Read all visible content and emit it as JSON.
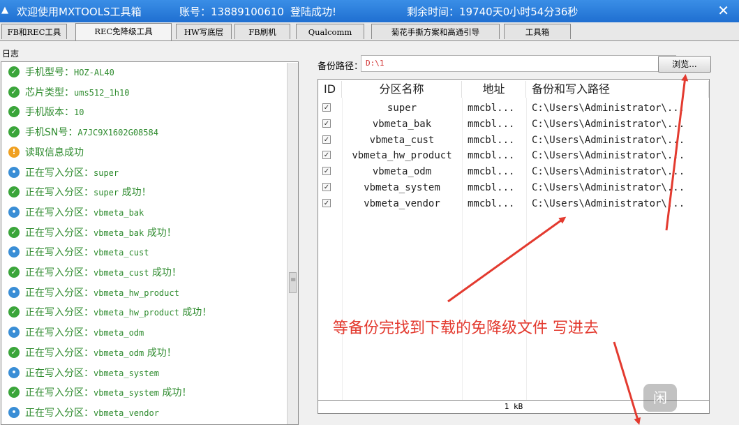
{
  "titlebar": {
    "app_title": "欢迎使用MXTOOLS工具箱",
    "account": "账号：13889100610",
    "login_status": "登陆成功!",
    "remaining_time": "剩余时间：19740天0小时54分36秒"
  },
  "tabs": [
    {
      "label": "FB和REC工具"
    },
    {
      "label": "REC免降级工具"
    },
    {
      "label": "HW写底层"
    },
    {
      "label": "FB刷机"
    },
    {
      "label": "Qualcomm"
    },
    {
      "label": "菊花手撕方案和高通引导"
    },
    {
      "label": "工具箱"
    }
  ],
  "log": {
    "label": "日志",
    "lines": [
      {
        "status": "success",
        "text": "手机型号：",
        "value": "HOZ-AL40",
        "suffix": ""
      },
      {
        "status": "success",
        "text": "芯片类型：",
        "value": "ums512_1h10",
        "suffix": ""
      },
      {
        "status": "success",
        "text": "手机版本：",
        "value": "10",
        "suffix": ""
      },
      {
        "status": "success",
        "text": "手机SN号：",
        "value": "A7JC9X1602G08584",
        "suffix": ""
      },
      {
        "status": "warning",
        "text": "读取信息成功",
        "value": "",
        "suffix": ""
      },
      {
        "status": "info",
        "text": "正在写入分区：",
        "value": "super",
        "suffix": ""
      },
      {
        "status": "success",
        "text": "正在写入分区：",
        "value": "super",
        "suffix": " 成功！"
      },
      {
        "status": "info",
        "text": "正在写入分区：",
        "value": "vbmeta_bak",
        "suffix": ""
      },
      {
        "status": "success",
        "text": "正在写入分区：",
        "value": "vbmeta_bak",
        "suffix": " 成功！"
      },
      {
        "status": "info",
        "text": "正在写入分区：",
        "value": "vbmeta_cust",
        "suffix": ""
      },
      {
        "status": "success",
        "text": "正在写入分区：",
        "value": "vbmeta_cust",
        "suffix": " 成功！"
      },
      {
        "status": "info",
        "text": "正在写入分区：",
        "value": "vbmeta_hw_product",
        "suffix": ""
      },
      {
        "status": "success",
        "text": "正在写入分区：",
        "value": "vbmeta_hw_product",
        "suffix": " 成功！"
      },
      {
        "status": "info",
        "text": "正在写入分区：",
        "value": "vbmeta_odm",
        "suffix": ""
      },
      {
        "status": "success",
        "text": "正在写入分区：",
        "value": "vbmeta_odm",
        "suffix": " 成功！"
      },
      {
        "status": "info",
        "text": "正在写入分区：",
        "value": "vbmeta_system",
        "suffix": ""
      },
      {
        "status": "success",
        "text": "正在写入分区：",
        "value": "vbmeta_system",
        "suffix": " 成功！"
      },
      {
        "status": "info",
        "text": "正在写入分区：",
        "value": "vbmeta_vendor",
        "suffix": ""
      }
    ]
  },
  "backup": {
    "label": "备份路径：",
    "path": "D:\\1",
    "browse_label": "浏览..."
  },
  "table": {
    "headers": [
      "ID",
      "分区名称",
      "地址",
      "备份和写入路径"
    ],
    "rows": [
      {
        "checked": true,
        "name": "super",
        "addr": "mmcbl...",
        "path": "C:\\Users\\Administrator\\..."
      },
      {
        "checked": true,
        "name": "vbmeta_bak",
        "addr": "mmcbl...",
        "path": "C:\\Users\\Administrator\\..."
      },
      {
        "checked": true,
        "name": "vbmeta_cust",
        "addr": "mmcbl...",
        "path": "C:\\Users\\Administrator\\..."
      },
      {
        "checked": true,
        "name": "vbmeta_hw_product",
        "addr": "mmcbl...",
        "path": "C:\\Users\\Administrator\\..."
      },
      {
        "checked": true,
        "name": "vbmeta_odm",
        "addr": "mmcbl...",
        "path": "C:\\Users\\Administrator\\..."
      },
      {
        "checked": true,
        "name": "vbmeta_system",
        "addr": "mmcbl...",
        "path": "C:\\Users\\Administrator\\..."
      },
      {
        "checked": true,
        "name": "vbmeta_vendor",
        "addr": "mmcbl...",
        "path": "C:\\Users\\Administrator\\..."
      }
    ]
  },
  "progress": {
    "text": "1 kB"
  },
  "annotation": {
    "text": "等备份完找到下载的免降级文件 写进去"
  },
  "colors": {
    "titlebar": "#1f6fd1",
    "log_text": "#2e8b2e",
    "success_icon": "#3aa53a",
    "warning_icon": "#f0a020",
    "info_icon": "#3a8ed6",
    "annotation": "#e33a2f"
  },
  "icons": {
    "success": "check-circle-icon",
    "warning": "exclamation-circle-icon",
    "info": "dot-circle-icon",
    "watermark": "watermark-logo-icon"
  }
}
